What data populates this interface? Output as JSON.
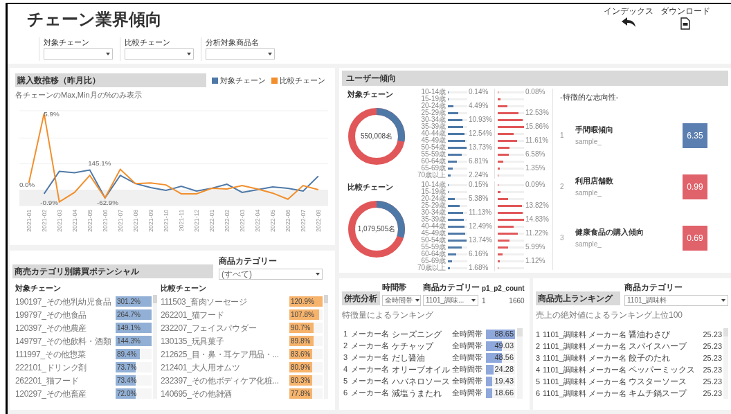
{
  "header": {
    "title": "チェーン業界傾向",
    "actions": [
      {
        "label": "インデックス",
        "kind": "back"
      },
      {
        "label": "ダウンロード",
        "kind": "pdf"
      }
    ]
  },
  "filters": [
    {
      "label": "対象チェーン"
    },
    {
      "label": "比較チェーン"
    },
    {
      "label": "分析対象商品名"
    }
  ],
  "purchase_trend": {
    "title": "購入数推移（昨月比）",
    "subtitle": "各チェーンのMax,Min月の%のみ表示",
    "legend": [
      {
        "label": "対象チェーン",
        "color": "#4e79a7"
      },
      {
        "label": "比較チェーン",
        "color": "#f28e2b"
      }
    ],
    "x_labels": [
      "2021-01",
      "2021-02",
      "2021-03",
      "2021-04",
      "2021-05",
      "2021-06",
      "2021-07",
      "2021-08",
      "2021-09",
      "2021-10",
      "2021-11",
      "2021-12",
      "2022-01",
      "2022-02",
      "2022-03",
      "2022-04",
      "2022-05",
      "2022-06",
      "2022-07",
      "2022-08"
    ],
    "point_labels": [
      "5.9%",
      "145.1%",
      "0.0%",
      "-0.9%",
      "-62.9%"
    ]
  },
  "user_trend": {
    "title": "ユーザー傾向",
    "segments": [
      {
        "title": "対象チェーン",
        "total": "550,008名",
        "ages": [
          {
            "age": "10-14歳",
            "left": {
              "level": 0.02,
              "label": "0.14%"
            },
            "right": {
              "level": 0.02,
              "label": "0.08%"
            }
          },
          {
            "age": "15-19歳",
            "left": {
              "level": 0.04
            },
            "right": {
              "level": 0.1
            }
          },
          {
            "age": "20-24歳",
            "left": {
              "level": 0.3,
              "label": "4.49%"
            },
            "right": {
              "level": 0.38
            }
          },
          {
            "age": "25-29歳",
            "left": {
              "level": 0.55
            },
            "right": {
              "level": 0.79,
              "label": "12.53%"
            }
          },
          {
            "age": "30-34歳",
            "left": {
              "level": 0.75,
              "label": "10.93%"
            },
            "right": {
              "level": 0.95
            }
          },
          {
            "age": "35-39歳",
            "left": {
              "level": 0.8
            },
            "right": {
              "level": 1,
              "label": "15.86%"
            }
          },
          {
            "age": "40-44歳",
            "left": {
              "level": 0.87,
              "label": "12.54%"
            },
            "right": {
              "level": 0.6
            }
          },
          {
            "age": "45-49歳",
            "left": {
              "level": 0.9
            },
            "right": {
              "level": 0.73,
              "label": "11.61%"
            }
          },
          {
            "age": "50-54歳",
            "left": {
              "level": 0.95,
              "label": "13.73%"
            },
            "right": {
              "level": 0.45
            }
          },
          {
            "age": "55-59歳",
            "left": {
              "level": 0.7
            },
            "right": {
              "level": 0.41,
              "label": "6.58%"
            }
          },
          {
            "age": "60-64歳",
            "left": {
              "level": 0.45,
              "label": "6.81%"
            },
            "right": {
              "level": 0.2
            }
          },
          {
            "age": "65-69歳",
            "left": {
              "level": 0.25
            },
            "right": {
              "level": 0.08,
              "label": "1.35%"
            }
          },
          {
            "age": "70歳以上",
            "left": {
              "level": 0.15,
              "label": "2.24%"
            },
            "right": {
              "level": 0.03
            }
          }
        ]
      },
      {
        "title": "比較チェーン",
        "total": "1,079,505名",
        "ages": [
          {
            "age": "10-14歳",
            "left": {
              "level": 0.02,
              "label": "0.15%"
            },
            "right": {
              "level": 0.02,
              "label": "0.09%"
            }
          },
          {
            "age": "15-19歳",
            "left": {
              "level": 0.05
            },
            "right": {
              "level": 0.1
            }
          },
          {
            "age": "20-24歳",
            "left": {
              "level": 0.37,
              "label": "5.38%"
            },
            "right": {
              "level": 0.4
            }
          },
          {
            "age": "25-29歳",
            "left": {
              "level": 0.6
            },
            "right": {
              "level": 0.93,
              "label": "13.82%"
            }
          },
          {
            "age": "30-34歳",
            "left": {
              "level": 0.78,
              "label": "11.13%"
            },
            "right": {
              "level": 0.95
            }
          },
          {
            "age": "35-39歳",
            "left": {
              "level": 0.82
            },
            "right": {
              "level": 1,
              "label": "14.83%"
            }
          },
          {
            "age": "40-44歳",
            "left": {
              "level": 0.87,
              "label": "12.49%"
            },
            "right": {
              "level": 0.6
            }
          },
          {
            "age": "45-49歳",
            "left": {
              "level": 0.9
            },
            "right": {
              "level": 0.76,
              "label": "11.22%"
            }
          },
          {
            "age": "50-54歳",
            "left": {
              "level": 0.95,
              "label": "13.74%"
            },
            "right": {
              "level": 0.45
            }
          },
          {
            "age": "55-59歳",
            "left": {
              "level": 0.7
            },
            "right": {
              "level": 0.4,
              "label": "5.99%"
            }
          },
          {
            "age": "60-64歳",
            "left": {
              "level": 0.43,
              "label": "6.16%"
            },
            "right": {
              "level": 0.18
            }
          },
          {
            "age": "65-69歳",
            "left": {
              "level": 0.2
            },
            "right": {
              "level": 0.07,
              "label": "1.12%"
            }
          },
          {
            "age": "70歳以上",
            "left": {
              "level": 0.1,
              "label": "1.68%"
            },
            "right": {
              "level": 0.03
            }
          }
        ]
      }
    ],
    "features": {
      "title": "-特徴的な志向性-",
      "items": [
        {
          "rank": "1",
          "name": "手間暇傾向",
          "note": "sample_",
          "value": "6.35",
          "color": "#5b7fb0"
        },
        {
          "rank": "2",
          "name": "利用店舗数",
          "note": "sample_",
          "value": "0.99",
          "color": "#e0626a"
        },
        {
          "rank": "3",
          "name": "健康食品の購入傾向",
          "note": "sample_",
          "value": "0.69",
          "color": "#e0626a"
        }
      ]
    }
  },
  "potential": {
    "title": "商売カテゴリ別購買ポテンシャル",
    "filter": {
      "label": "商品カテゴリー",
      "value": "(すべて)"
    },
    "columns": [
      {
        "title": "対象チェーン",
        "kind": "target",
        "rows": [
          {
            "name": "190197_その他乳幼児食品",
            "value": "301.2%",
            "level": 1
          },
          {
            "name": "199797_その他食品",
            "value": "264.7%",
            "level": 1
          },
          {
            "name": "120397_その他農産",
            "value": "149.1%",
            "level": 1
          },
          {
            "name": "149797_その他飲料・酒類",
            "value": "144.3%",
            "level": 1
          },
          {
            "name": "111997_その他惣菜",
            "value": "89.4%",
            "level": 0.68
          },
          {
            "name": "222101_ドリンク剤",
            "value": "73.7%",
            "level": 0.56
          },
          {
            "name": "262201_猫フード",
            "value": "73.4%",
            "level": 0.56
          },
          {
            "name": "120297_その他畜産",
            "value": "72.0%",
            "level": 0.56
          }
        ]
      },
      {
        "title": "比較チェーン",
        "kind": "compare",
        "rows": [
          {
            "name": "111503_畜肉ソーセージ",
            "value": "120.9%",
            "level": 1
          },
          {
            "name": "262201_猫フード",
            "value": "107.8%",
            "level": 0.89
          },
          {
            "name": "232207_フェイスパウダー",
            "value": "90.7%",
            "level": 0.73
          },
          {
            "name": "130135_玩具菓子",
            "value": "89.8%",
            "level": 0.73
          },
          {
            "name": "212625_目・鼻・耳ケア用品・...",
            "value": "83.6%",
            "level": 0.68
          },
          {
            "name": "212401_大人用オムツ",
            "value": "80.9%",
            "level": 0.68
          },
          {
            "name": "232397_その他ボディケア化粧...",
            "value": "80.3%",
            "level": 0.68
          },
          {
            "name": "140695_その他雑酒",
            "value": "77.8%",
            "level": 0.68
          }
        ]
      }
    ]
  },
  "bundle": {
    "title": "併売分析",
    "filters": [
      {
        "label": "時間帯",
        "value": "全時間帯"
      },
      {
        "label": "商品カテゴリー",
        "value": "1101_調味..."
      }
    ],
    "count": {
      "label": "p1_p2_count",
      "values": [
        "1",
        "1660"
      ]
    },
    "subtitle": "特徴量によるランキング",
    "rows": [
      {
        "rank": "1",
        "maker": "メーカー名",
        "product": "シーズニング",
        "time": "全時間帯",
        "value": "88.65",
        "level": 1
      },
      {
        "rank": "2",
        "maker": "メーカー名",
        "product": "ケチャップ",
        "time": "全時間帯",
        "value": "49.03",
        "level": 0.55
      },
      {
        "rank": "3",
        "maker": "メーカー名",
        "product": "だし醤油",
        "time": "全時間帯",
        "value": "48.56",
        "level": 0.55
      },
      {
        "rank": "4",
        "maker": "メーカー名",
        "product": "オリーブオイル",
        "time": "全時間帯",
        "value": "24.28",
        "level": 0.27
      },
      {
        "rank": "5",
        "maker": "メーカー名",
        "product": "ハバネロソース",
        "time": "全時間帯",
        "value": "19.43",
        "level": 0.22
      },
      {
        "rank": "6",
        "maker": "メーカー名",
        "product": "減塩うまたれ",
        "time": "全時間帯",
        "value": "18.66",
        "level": 0.21
      }
    ]
  },
  "ranking": {
    "title": "商品売上ランキング",
    "filter": {
      "label": "商品カテゴリー",
      "value": "1101_調味料"
    },
    "subtitle": "売上の絶対値によるランキング上位100",
    "rows": [
      {
        "rank": "1",
        "category": "1101_調味料",
        "maker": "メーカー名",
        "product": "醤油わさび",
        "value": "25.23"
      },
      {
        "rank": "2",
        "category": "1101_調味料",
        "maker": "メーカー名",
        "product": "スパイスハーブ",
        "value": "25.23"
      },
      {
        "rank": "3",
        "category": "1101_調味料",
        "maker": "メーカー名",
        "product": "餃子のたれ",
        "value": "25.23"
      },
      {
        "rank": "4",
        "category": "1101_調味料",
        "maker": "メーカー名",
        "product": "ペッパーミックス",
        "value": "25.23"
      },
      {
        "rank": "5",
        "category": "1101_調味料",
        "maker": "メーカー名",
        "product": "ウスターソース",
        "value": "25.23"
      },
      {
        "rank": "6",
        "category": "1101_調味料",
        "maker": "メーカー名",
        "product": "キムチ鍋スープ",
        "value": "25.23"
      }
    ]
  }
}
